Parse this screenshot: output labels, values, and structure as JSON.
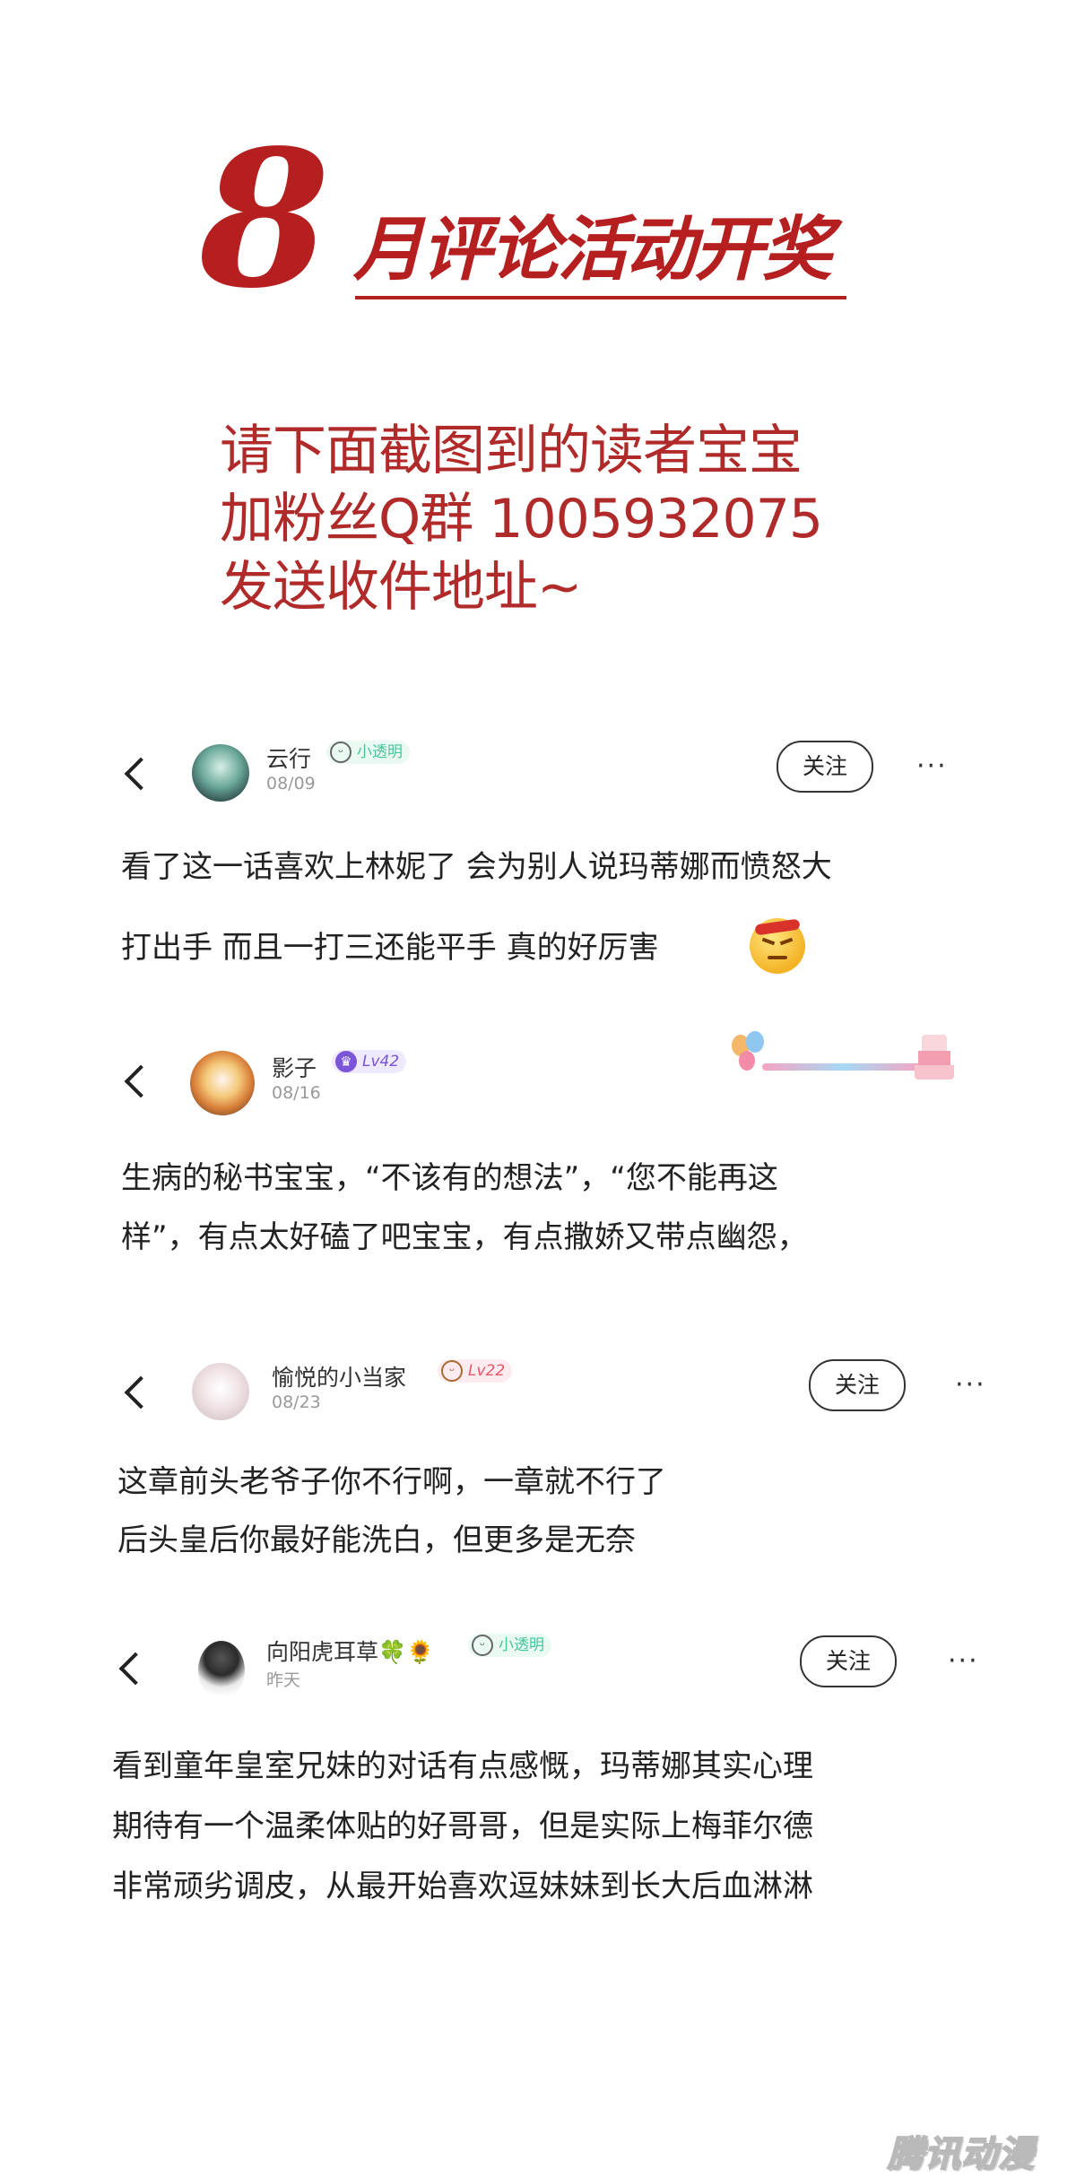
{
  "header": {
    "big_number": "8",
    "title": "月评论活动开奖",
    "notice_lines": [
      "请下面截图到的读者宝宝",
      "加粉丝Q群 1005932075",
      "发送收件地址~"
    ]
  },
  "comments": [
    {
      "username": "云行",
      "date": "08/09",
      "badge": "小透明",
      "follow_label": "关注",
      "more_label": "···",
      "lines": [
        "看了这一话喜欢上林妮了 会为别人说玛蒂娜而愤怒大",
        "打出手 而且一打三还能平手 真的好厉害"
      ]
    },
    {
      "username": "影子",
      "date": "08/16",
      "badge": "Lv42",
      "lines": [
        "生病的秘书宝宝，“不该有的想法”，“您不能再这",
        "样”，有点太好磕了吧宝宝，有点撒娇又带点幽怨，"
      ]
    },
    {
      "username": "愉悦的小当家",
      "date": "08/23",
      "badge": "Lv22",
      "follow_label": "关注",
      "more_label": "···",
      "lines": [
        "这章前头老爷子你不行啊，一章就不行了",
        "后头皇后你最好能洗白，但更多是无奈"
      ]
    },
    {
      "username": "向阳虎耳草🍀🌻",
      "date": "昨天",
      "badge": "小透明",
      "follow_label": "关注",
      "more_label": "···",
      "lines": [
        "看到童年皇室兄妹的对话有点感慨，玛蒂娜其实心理",
        "期待有一个温柔体贴的好哥哥，但是实际上梅菲尔德",
        "非常顽劣调皮，从最开始喜欢逗妹妹到长大后血淋淋"
      ]
    }
  ],
  "watermark": "腾讯动漫",
  "colors": {
    "accent": "#b51f1f",
    "notice": "#b02a2a",
    "badge_green": "#47c49a",
    "badge_purple": "#7b55d8",
    "badge_pink": "#e7596b"
  }
}
